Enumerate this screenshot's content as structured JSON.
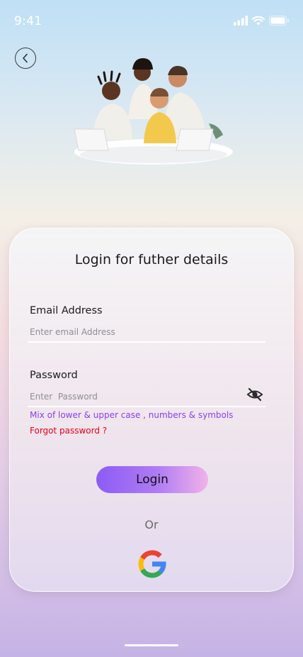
{
  "status_bar": {
    "time": "9:41"
  },
  "login": {
    "title": "Login for futher details",
    "email_label": "Email Address",
    "email_placeholder": "Enter email Address",
    "password_label": "Password",
    "password_placeholder": "Enter  Password",
    "password_hint": "Mix of lower & upper case , numbers & symbols",
    "forgot_password": "Forgot password ?",
    "login_button": "Login",
    "or_text": "Or"
  },
  "icons": {
    "back": "chevron-left-icon",
    "password_toggle": "eye-off-icon",
    "social": "google-icon"
  },
  "colors": {
    "hint": "#8b3df0",
    "forgot": "#e3001b",
    "button_start": "#8b5cf6",
    "button_end": "#f0b3e8"
  }
}
